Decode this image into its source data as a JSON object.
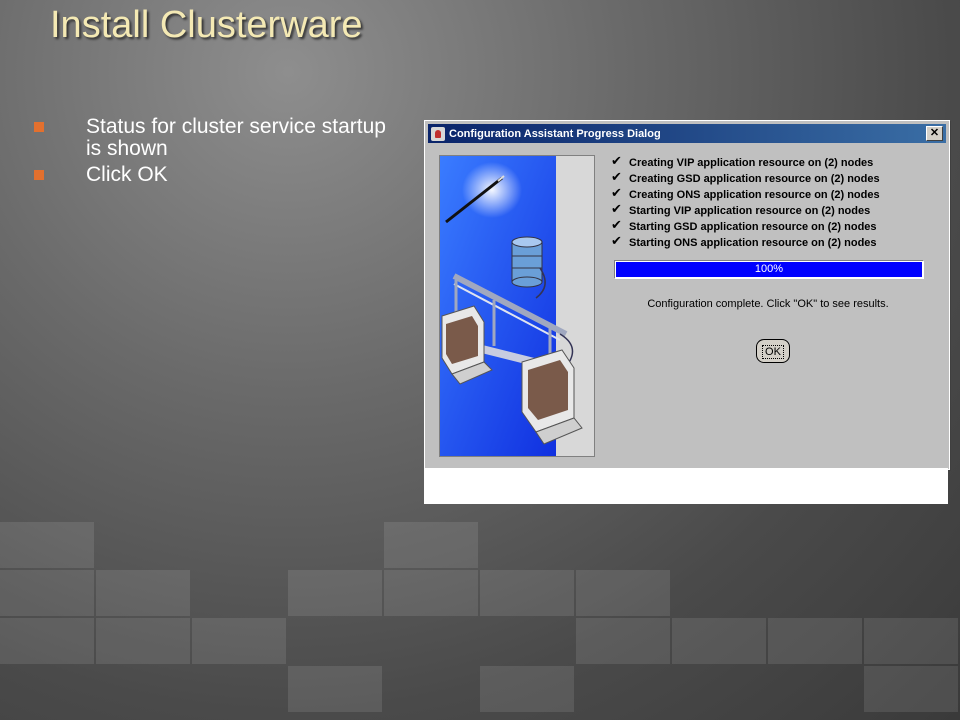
{
  "slide": {
    "title": "Install Clusterware",
    "bullets": [
      "Status for cluster service startup is shown",
      "Click OK"
    ]
  },
  "dialog": {
    "title": "Configuration Assistant Progress Dialog",
    "close_label": "✕",
    "check_glyph": "✔",
    "steps": [
      "Creating VIP application resource on (2) nodes",
      "Creating GSD application resource on (2) nodes",
      "Creating ONS application resource on (2) nodes",
      "Starting VIP application resource on (2) nodes",
      "Starting GSD application resource on (2) nodes",
      "Starting ONS application resource on (2) nodes"
    ],
    "progress": {
      "value": 100,
      "label": "100%"
    },
    "status_message": "Configuration complete. Click \"OK\" to see results.",
    "ok_label": "OK"
  },
  "colors": {
    "title": "#f4e9b4",
    "bullet_marker": "#e3702e",
    "progress_fill": "#0000ff",
    "titlebar": "#0a246a"
  }
}
